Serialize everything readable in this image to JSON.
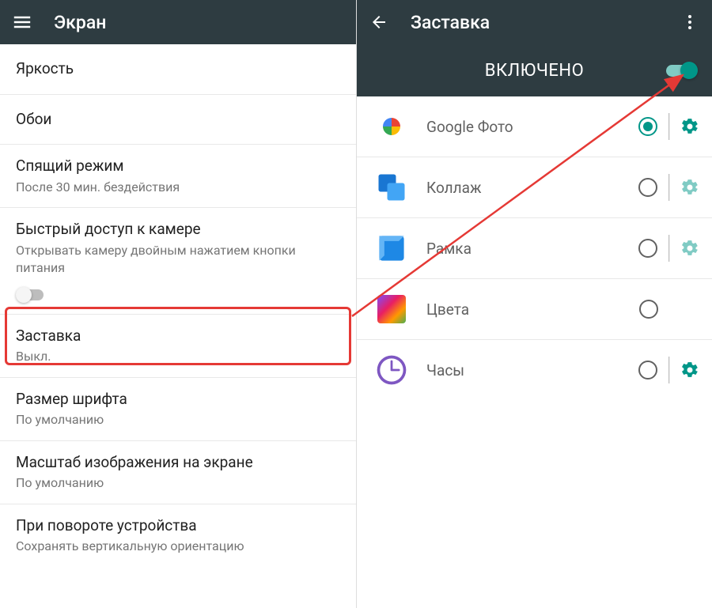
{
  "left": {
    "title": "Экран",
    "items": [
      {
        "primary": "Яркость"
      },
      {
        "primary": "Обои"
      },
      {
        "primary": "Спящий режим",
        "secondary": "После 30 мин. бездействия"
      },
      {
        "primary": "Быстрый доступ к камере",
        "secondary": "Открывать камеру двойным нажатием кнопки питания",
        "switch": true,
        "switch_on": false
      },
      {
        "primary": "Заставка",
        "secondary": "Выкл."
      },
      {
        "primary": "Размер шрифта",
        "secondary": "По умолчанию"
      },
      {
        "primary": "Масштаб изображения на экране",
        "secondary": "По умолчанию"
      },
      {
        "primary": "При повороте устройства",
        "secondary": "Сохранять вертикальную ориентацию"
      }
    ]
  },
  "right": {
    "title": "Заставка",
    "status_label": "ВКЛЮЧЕНО",
    "status_on": true,
    "items": [
      {
        "label": "Google Фото",
        "icon": "google-photos",
        "selected": true,
        "gear": true,
        "gear_active": true
      },
      {
        "label": "Коллаж",
        "icon": "collage",
        "selected": false,
        "gear": true,
        "gear_active": false
      },
      {
        "label": "Рамка",
        "icon": "frame",
        "selected": false,
        "gear": true,
        "gear_active": false
      },
      {
        "label": "Цвета",
        "icon": "colors",
        "selected": false,
        "gear": false
      },
      {
        "label": "Часы",
        "icon": "clock",
        "selected": false,
        "gear": true,
        "gear_active": true
      }
    ]
  },
  "colors": {
    "appbar": "#2e3c41",
    "accent": "#009688",
    "highlight": "#e53935"
  }
}
